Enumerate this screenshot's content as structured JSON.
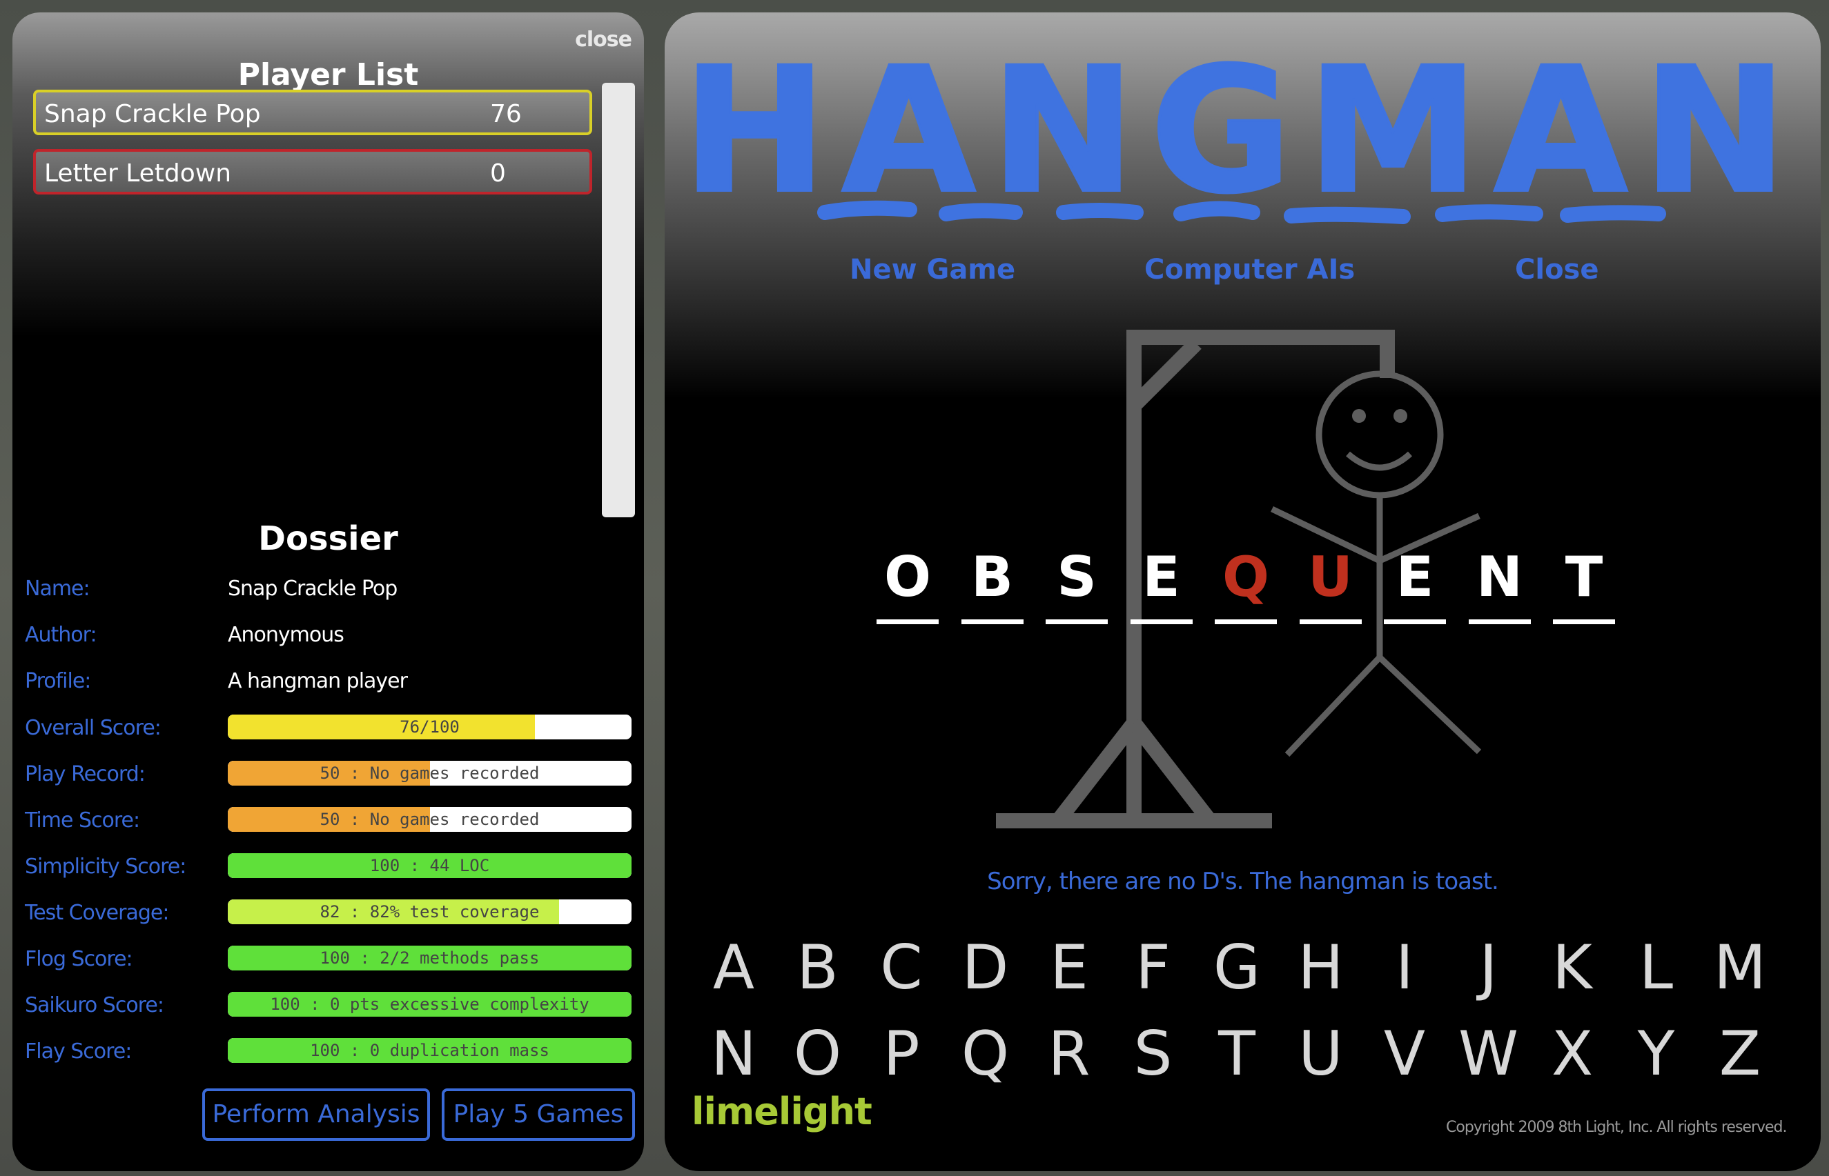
{
  "player_list": {
    "close_label": "close",
    "title": "Player List",
    "players": [
      {
        "name": "Snap Crackle Pop",
        "score": "76"
      },
      {
        "name": "Letter Letdown",
        "score": "0"
      }
    ]
  },
  "dossier": {
    "title": "Dossier",
    "name_label": "Name:",
    "name": "Snap Crackle Pop",
    "author_label": "Author:",
    "author": "Anonymous",
    "profile_label": "Profile:",
    "profile": "A hangman player",
    "scores": [
      {
        "label": "Overall Score:",
        "text": "76/100",
        "fraction": 0.76,
        "color": "#f2e22e"
      },
      {
        "label": "Play Record:",
        "text": "50 : No games recorded",
        "fraction": 0.5,
        "color": "#f0a535"
      },
      {
        "label": "Time Score:",
        "text": "50 : No games recorded",
        "fraction": 0.5,
        "color": "#f0a535"
      },
      {
        "label": "Simplicity Score:",
        "text": "100 : 44 LOC",
        "fraction": 1.0,
        "color": "#5fe03a"
      },
      {
        "label": "Test Coverage:",
        "text": "82 : 82% test coverage",
        "fraction": 0.82,
        "color": "#c6f04a"
      },
      {
        "label": "Flog Score:",
        "text": "100 : 2/2 methods pass",
        "fraction": 1.0,
        "color": "#5fe03a"
      },
      {
        "label": "Saikuro Score:",
        "text": "100 : 0 pts excessive complexity",
        "fraction": 1.0,
        "color": "#5fe03a"
      },
      {
        "label": "Flay Score:",
        "text": "100 : 0 duplication mass",
        "fraction": 1.0,
        "color": "#5fe03a"
      }
    ],
    "buttons": {
      "analyze": "Perform Analysis",
      "play": "Play 5 Games"
    }
  },
  "game": {
    "title": "HANGMAN",
    "menu": {
      "new_game": "New Game",
      "computer_ais": "Computer AIs",
      "close": "Close"
    },
    "word": [
      {
        "letter": "O",
        "wrong": false
      },
      {
        "letter": "B",
        "wrong": false
      },
      {
        "letter": "S",
        "wrong": false
      },
      {
        "letter": "E",
        "wrong": false
      },
      {
        "letter": "Q",
        "wrong": true
      },
      {
        "letter": "U",
        "wrong": true
      },
      {
        "letter": "E",
        "wrong": false
      },
      {
        "letter": "N",
        "wrong": false
      },
      {
        "letter": "T",
        "wrong": false
      }
    ],
    "status": "Sorry, there are no D's. The hangman is toast.",
    "keyboard_row1": [
      "A",
      "B",
      "C",
      "D",
      "E",
      "F",
      "G",
      "H",
      "I",
      "J",
      "K",
      "L",
      "M"
    ],
    "keyboard_row2": [
      "N",
      "O",
      "P",
      "Q",
      "R",
      "S",
      "T",
      "U",
      "V",
      "W",
      "X",
      "Y",
      "Z"
    ],
    "brand": "limelight",
    "copyright": "Copyright 2009 8th Light, Inc. All rights reserved.",
    "colors": {
      "accent": "#3a6ad8",
      "wrong": "#c0301e",
      "brand": "#a7c936"
    }
  }
}
